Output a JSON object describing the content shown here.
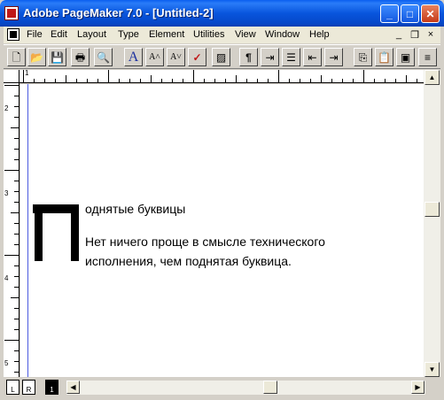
{
  "window": {
    "title": "Adobe PageMaker 7.0 - [Untitled-2]",
    "minimize_glyph": "_",
    "maximize_glyph": "□",
    "close_glyph": "✕"
  },
  "menu": {
    "items": [
      "File",
      "Edit",
      "Layout",
      "Type",
      "Element",
      "Utilities",
      "View",
      "Window",
      "Help"
    ],
    "mdi_minimize": "_",
    "mdi_restore": "❐",
    "mdi_close": "×"
  },
  "toolbar": {
    "buttons": [
      {
        "name": "new-icon",
        "glyph": "🗋"
      },
      {
        "name": "open-icon",
        "glyph": "📂"
      },
      {
        "name": "save-icon",
        "glyph": "💾"
      },
      {
        "name": "print-icon",
        "glyph": "🖶"
      },
      {
        "name": "find-icon",
        "glyph": "🔍"
      },
      {
        "name": "character-format-icon",
        "glyph": "A"
      },
      {
        "name": "increase-font-icon",
        "glyph": "A˄"
      },
      {
        "name": "decrease-font-icon",
        "glyph": "A˅"
      },
      {
        "name": "spelling-icon",
        "glyph": "✓"
      },
      {
        "name": "fill-stroke-icon",
        "glyph": "▨"
      },
      {
        "name": "paragraph-icon",
        "glyph": "¶"
      },
      {
        "name": "indents-tabs-icon",
        "glyph": "⇥"
      },
      {
        "name": "bullets-icon",
        "glyph": "☰"
      },
      {
        "name": "decrease-indent-icon",
        "glyph": "⇤"
      },
      {
        "name": "increase-indent-icon",
        "glyph": "⇥"
      },
      {
        "name": "copy-icon",
        "glyph": "⎘"
      },
      {
        "name": "paste-icon",
        "glyph": "📋"
      },
      {
        "name": "place-icon",
        "glyph": "▣"
      },
      {
        "name": "more-icon",
        "glyph": "≡"
      }
    ]
  },
  "ruler": {
    "top_label": "1",
    "left_labels": [
      "2",
      "3",
      "4",
      "5"
    ]
  },
  "document": {
    "heading": "однятые буквицы",
    "body_line1": "Нет ничего проще в смысле технического",
    "body_line2": "исполнения, чем поднятая буквица."
  },
  "pages": {
    "left": "L",
    "right": "R",
    "current": "1"
  }
}
